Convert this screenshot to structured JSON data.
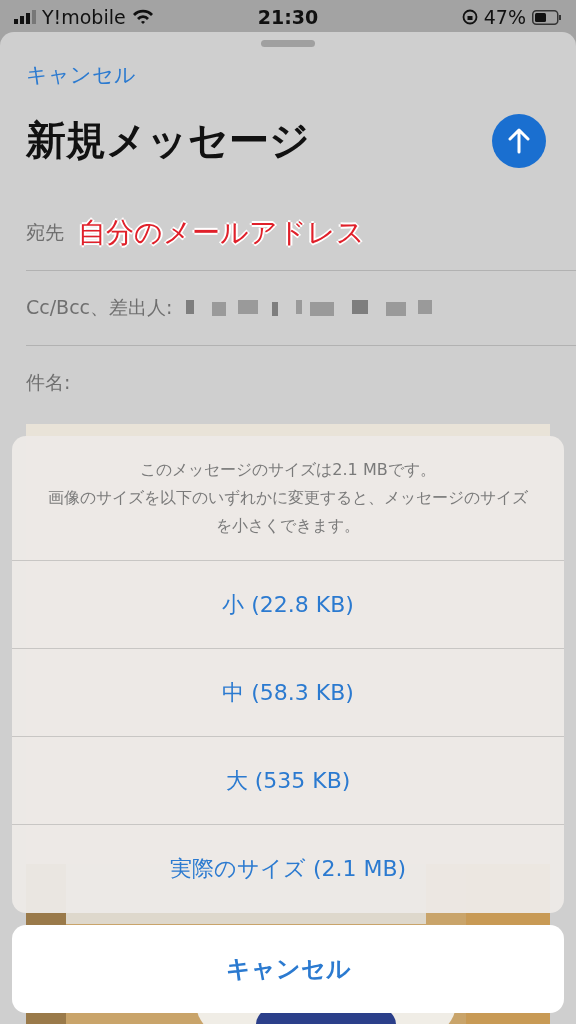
{
  "status_bar": {
    "carrier": "Y!mobile",
    "time": "21:30",
    "battery": "47%"
  },
  "compose": {
    "cancel": "キャンセル",
    "title": "新規メッセージ",
    "fields": [
      {
        "kind": "to",
        "label": "宛先",
        "annotation": "自分のメールアドレス"
      },
      {
        "kind": "from",
        "label": "Cc/Bcc、差出人:"
      },
      {
        "kind": "subject",
        "label": "件名:"
      }
    ]
  },
  "action_sheet": {
    "message": [
      "このメッセージのサイズは2.1 MBです。",
      "画像のサイズを以下のいずれかに変更すると、メッセージのサイズを小さくできます。"
    ],
    "options": [
      "小 (22.8 KB)",
      "中 (58.3 KB)",
      "大 (535 KB)",
      "実際のサイズ (2.1 MB)"
    ],
    "cancel": "キャンセル"
  }
}
